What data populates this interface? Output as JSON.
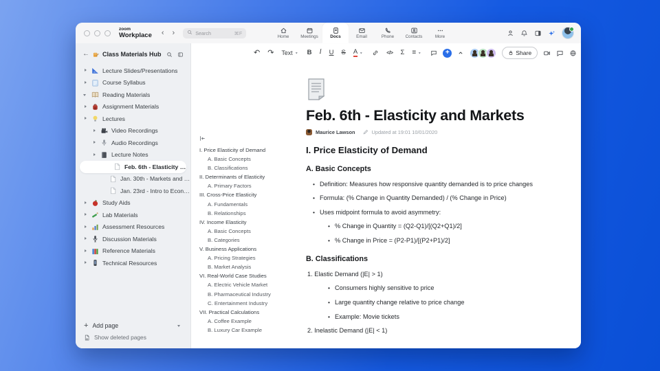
{
  "colors": {
    "accent": "#2a6ee8",
    "bg_gradient_start": "#7ba3f0",
    "bg_gradient_end": "#0a4fd6",
    "sidebar_bg": "#eef0f3"
  },
  "titlebar": {
    "logo_top": "zoom",
    "logo_bottom": "Workplace",
    "search": {
      "placeholder": "Search",
      "shortcut": "⌘F"
    },
    "tabs": [
      {
        "label": "Home",
        "icon": "home",
        "active": false
      },
      {
        "label": "Meetings",
        "icon": "calendar",
        "active": false
      },
      {
        "label": "Docs",
        "icon": "doc",
        "active": true
      },
      {
        "label": "Email",
        "icon": "mail",
        "active": false
      },
      {
        "label": "Phone",
        "icon": "phone",
        "active": false
      },
      {
        "label": "Contacts",
        "icon": "contacts",
        "active": false
      },
      {
        "label": "More",
        "icon": "more",
        "active": false
      }
    ]
  },
  "sidebar": {
    "title": "Class Materials Hub",
    "tree": [
      {
        "icon": "ruler",
        "chev": "right",
        "label": "Lecture Slides/Presentations",
        "indent": 0
      },
      {
        "icon": "clipboard",
        "chev": "right",
        "label": "Course Syllabus",
        "indent": 0
      },
      {
        "icon": "openbook",
        "chev": "down",
        "label": "Reading Materials",
        "indent": 0
      },
      {
        "icon": "backpack",
        "chev": "right",
        "label": "Assignment Materials",
        "indent": 0
      },
      {
        "icon": "bulb",
        "chev": "right",
        "label": "Lectures",
        "indent": 0
      },
      {
        "icon": "camera",
        "chev": "right",
        "label": "Video Recordings",
        "indent": 1
      },
      {
        "icon": "mic",
        "chev": "right",
        "label": "Audio Recordings",
        "indent": 1
      },
      {
        "icon": "notebook",
        "chev": "right",
        "label": "Lecture Notes",
        "indent": 1
      },
      {
        "icon": "page",
        "label": "Feb. 6th - Elasticity and M...",
        "indent": 2,
        "selected": true
      },
      {
        "icon": "page",
        "label": "Jan. 30th - Markets and P...",
        "indent": 2
      },
      {
        "icon": "page",
        "label": "Jan. 23rd - Intro to Econo...",
        "indent": 2
      },
      {
        "icon": "apple",
        "chev": "right",
        "label": "Study Aids",
        "indent": 0
      },
      {
        "icon": "pencil",
        "chev": "right",
        "label": "Lab Materials",
        "indent": 0
      },
      {
        "icon": "chart",
        "chev": "right",
        "label": "Assessment Resources",
        "indent": 0
      },
      {
        "icon": "micdark",
        "chev": "right",
        "label": "Discussion Materials",
        "indent": 0
      },
      {
        "icon": "books",
        "chev": "right",
        "label": "Reference Materials",
        "indent": 0
      },
      {
        "icon": "phonedark",
        "chev": "right",
        "label": "Technical Resources",
        "indent": 0
      }
    ],
    "add_page": "Add page",
    "show_deleted": "Show deleted pages"
  },
  "toolbar": {
    "share_label": "Share",
    "buttons": [
      {
        "name": "undo",
        "glyph": "↶"
      },
      {
        "name": "redo",
        "glyph": "↷"
      },
      {
        "name": "text-style",
        "glyph": "Text",
        "chev": true
      },
      {
        "name": "bold",
        "glyph": "B"
      },
      {
        "name": "italic",
        "glyph": "I"
      },
      {
        "name": "underline",
        "glyph": "U"
      },
      {
        "name": "strikethrough",
        "glyph": "S"
      },
      {
        "name": "text-color",
        "glyph": "A",
        "chev": true
      },
      {
        "name": "link",
        "svg": "link"
      },
      {
        "name": "code",
        "glyph": "</>"
      },
      {
        "name": "formula",
        "glyph": "Σ"
      },
      {
        "name": "align",
        "glyph": "≡",
        "chev": true
      },
      {
        "name": "comment",
        "svg": "chat"
      },
      {
        "name": "insert",
        "glyph": "+"
      },
      {
        "name": "collapse",
        "svg": "chevup"
      }
    ],
    "avatars": [
      {
        "color": "#abccf2"
      },
      {
        "color": "#b9e2c3"
      },
      {
        "color": "#cdbcee"
      }
    ]
  },
  "outline": {
    "items": [
      {
        "level": 1,
        "text": "I. Price Elasticity of Demand"
      },
      {
        "level": 2,
        "text": "A. Basic Concepts"
      },
      {
        "level": 2,
        "text": "B. Classifications"
      },
      {
        "level": 1,
        "text": "II. Determinants of Elasticity"
      },
      {
        "level": 2,
        "text": "A. Primary Factors"
      },
      {
        "level": 1,
        "text": "III. Cross-Price Elasticity"
      },
      {
        "level": 2,
        "text": "A. Fundamentals"
      },
      {
        "level": 2,
        "text": "B. Relationships"
      },
      {
        "level": 1,
        "text": "IV. Income Elasticity"
      },
      {
        "level": 2,
        "text": "A. Basic Concepts"
      },
      {
        "level": 2,
        "text": "B. Categories"
      },
      {
        "level": 1,
        "text": "V. Business Applications"
      },
      {
        "level": 2,
        "text": "A. Pricing Strategies"
      },
      {
        "level": 2,
        "text": "B. Market Analysis"
      },
      {
        "level": 1,
        "text": "VI. Real-World Case Studies"
      },
      {
        "level": 2,
        "text": "A. Electric Vehicle Market"
      },
      {
        "level": 2,
        "text": "B. Pharmaceutical Industry"
      },
      {
        "level": 2,
        "text": "C. Entertainment Industry"
      },
      {
        "level": 1,
        "text": "VII. Practical Calculations"
      },
      {
        "level": 2,
        "text": "A. Coffee Example"
      },
      {
        "level": 2,
        "text": "B. Luxury Car Example"
      }
    ]
  },
  "doc": {
    "title": "Feb. 6th - Elasticity and Markets",
    "author": "Maurice Lawson",
    "updated": "Updated at 19:01 10/01/2020",
    "blocks": [
      {
        "type": "h2",
        "text": "I. Price Elasticity of Demand"
      },
      {
        "type": "h3",
        "text": "A. Basic Concepts"
      },
      {
        "type": "bullet",
        "level": 1,
        "text": "Definition: Measures how responsive quantity demanded is to price changes"
      },
      {
        "type": "bullet",
        "level": 1,
        "text": "Formula: (% Change in Quantity Demanded) / (% Change in Price)"
      },
      {
        "type": "bullet",
        "level": 1,
        "text": "Uses midpoint formula to avoid asymmetry:"
      },
      {
        "type": "bullet",
        "level": 2,
        "text": "% Change in Quantity = (Q2-Q1)/[(Q2+Q1)/2]"
      },
      {
        "type": "bullet",
        "level": 2,
        "text": "% Change in Price = (P2-P1)/[(P2+P1)/2]"
      },
      {
        "type": "h3",
        "text": "B. Classifications"
      },
      {
        "type": "num",
        "text": "1. Elastic Demand (|E| > 1)"
      },
      {
        "type": "bullet",
        "level": 2,
        "text": "Consumers highly sensitive to price"
      },
      {
        "type": "bullet",
        "level": 2,
        "text": "Large quantity change relative to price change"
      },
      {
        "type": "bullet",
        "level": 2,
        "text": "Example: Movie tickets"
      },
      {
        "type": "num",
        "text": "2. Inelastic Demand (|E| < 1)"
      }
    ]
  }
}
